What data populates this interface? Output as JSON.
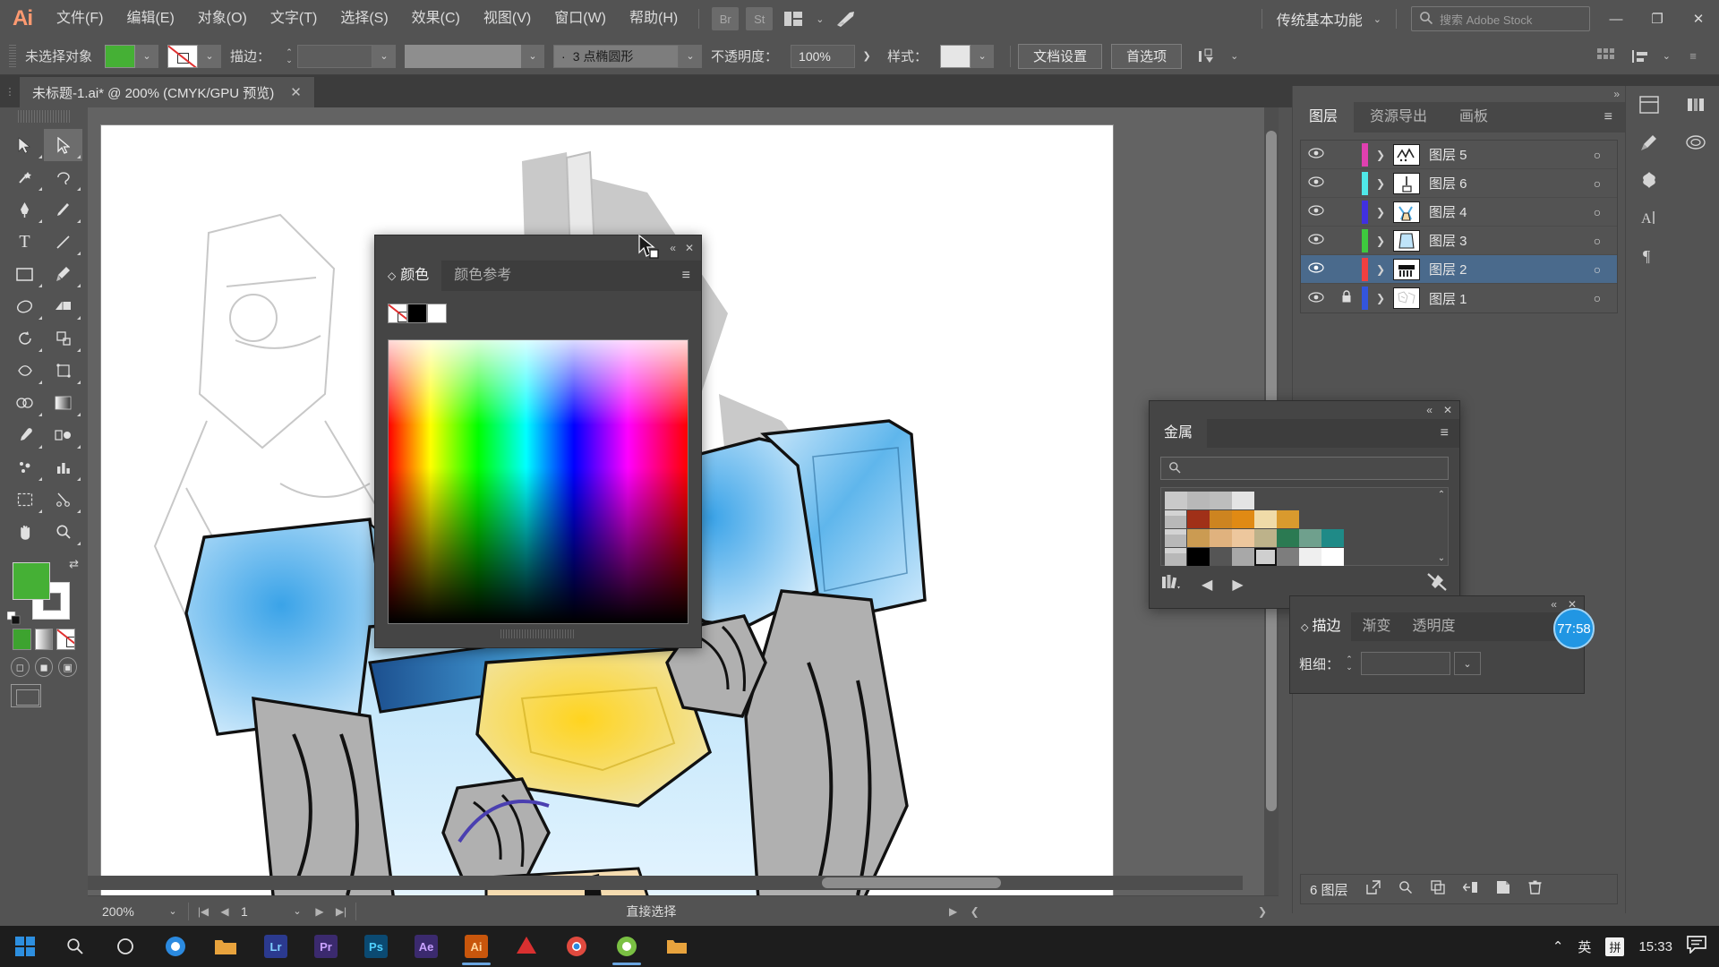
{
  "app": {
    "logo": "Ai",
    "menus": [
      "文件(F)",
      "编辑(E)",
      "对象(O)",
      "文字(T)",
      "选择(S)",
      "效果(C)",
      "视图(V)",
      "窗口(W)",
      "帮助(H)"
    ],
    "bridge_icon_label": "Br",
    "stock_icon_label": "St",
    "workspace": "传统基本功能",
    "search_placeholder": "搜索 Adobe Stock",
    "window_buttons": {
      "minimize": "—",
      "maximize": "❐",
      "close": "✕"
    }
  },
  "control_bar": {
    "selection_status": "未选择对象",
    "fill_color": "#45b035",
    "stroke_color": "none",
    "stroke_label": "描边：",
    "stroke_weight": "",
    "brush_profile": "",
    "brush_definition": "3 点椭圆形",
    "brush_bullet": "·",
    "opacity_label": "不透明度：",
    "opacity_value": "100%",
    "opacity_arrow": "❯",
    "style_label": "样式：",
    "document_setup": "文档设置",
    "preferences": "首选项",
    "align_caret": "⌄"
  },
  "document_tab": {
    "title": "未标题-1.ai* @ 200% (CMYK/GPU 预览)",
    "close": "✕"
  },
  "toolbar": {
    "tools": [
      {
        "name": "selection-tool",
        "glyph": "⬈",
        "selected": false
      },
      {
        "name": "direct-selection-tool",
        "glyph": "⬋",
        "selected": true
      },
      {
        "name": "magic-wand-tool",
        "glyph": "✧",
        "selected": false
      },
      {
        "name": "lasso-tool",
        "glyph": "◠",
        "selected": false
      },
      {
        "name": "pen-tool",
        "glyph": "✒",
        "selected": false
      },
      {
        "name": "curvature-tool",
        "glyph": "✎",
        "selected": false
      },
      {
        "name": "type-tool",
        "glyph": "T",
        "selected": false
      },
      {
        "name": "line-segment-tool",
        "glyph": "╱",
        "selected": false
      },
      {
        "name": "rectangle-tool",
        "glyph": "▭",
        "selected": false
      },
      {
        "name": "paintbrush-tool",
        "glyph": "🖌",
        "selected": false
      },
      {
        "name": "shaper-tool",
        "glyph": "◌",
        "selected": false
      },
      {
        "name": "eraser-tool",
        "glyph": "◨",
        "selected": false
      },
      {
        "name": "rotate-tool",
        "glyph": "↻",
        "selected": false
      },
      {
        "name": "scale-tool",
        "glyph": "⤢",
        "selected": false
      },
      {
        "name": "width-tool",
        "glyph": "⌘",
        "selected": false
      },
      {
        "name": "free-transform-tool",
        "glyph": "✛",
        "selected": false
      },
      {
        "name": "shape-builder-tool",
        "glyph": "◕",
        "selected": false
      },
      {
        "name": "gradient-tool",
        "glyph": "▦",
        "selected": false
      },
      {
        "name": "eyedropper-tool",
        "glyph": "⚲",
        "selected": false
      },
      {
        "name": "blend-tool",
        "glyph": "❏",
        "selected": false
      },
      {
        "name": "symbol-sprayer-tool",
        "glyph": "❋",
        "selected": false
      },
      {
        "name": "column-graph-tool",
        "glyph": "📊",
        "selected": false
      },
      {
        "name": "artboard-tool",
        "glyph": "⊞",
        "selected": false
      },
      {
        "name": "slice-tool",
        "glyph": "✂",
        "selected": false
      },
      {
        "name": "hand-tool",
        "glyph": "✋",
        "selected": false
      },
      {
        "name": "zoom-tool",
        "glyph": "🔍",
        "selected": false
      }
    ],
    "fill_color": "#45b035",
    "stroke_color": "#ffffff",
    "swap_glyph": "⇄",
    "screen_modes": [
      "normal",
      "full-menu",
      "full"
    ]
  },
  "color_panel": {
    "collapse": "«",
    "close": "✕",
    "tabs": [
      {
        "label": "颜色",
        "active": true
      },
      {
        "label": "颜色参考",
        "active": false
      }
    ],
    "menu_glyph": "≡",
    "swatches": [
      "none",
      "#000000",
      "#ffffff"
    ],
    "spectrum_label": "色谱"
  },
  "metal_panel": {
    "collapse": "«",
    "close": "✕",
    "tab": "金属",
    "menu_glyph": "≡",
    "search_icon": "search-icon",
    "search_value": "",
    "swatch_rows": [
      [
        "#c9c9c9",
        "#b8b8b8",
        "#bdbdbd",
        "#e4e4e4"
      ],
      [
        "__folder__",
        "#a03018",
        "#cd8420",
        "#e08a14",
        "#f0dba8",
        "#d99a2e"
      ],
      [
        "__folder__",
        "#cb9b52",
        "#e0b27e",
        "#edc79d",
        "#bdb28a",
        "#2b7a52",
        "#6fa08d",
        "#1f8a87"
      ],
      [
        "__folder__",
        "#000000",
        "#555555",
        "#a8a8a8",
        "#cfcfcf",
        "#7d7d7d",
        "#efefef",
        "#ffffff"
      ]
    ],
    "selected_swatch": "#cfcfcf",
    "footer": {
      "library": "swatch-libraries-icon",
      "prev": "◀",
      "next": "▶",
      "break_link": "break-link-icon"
    },
    "scroll_up": "⌃",
    "scroll_down": "⌄"
  },
  "stroke_panel": {
    "collapse": "«",
    "close": "✕",
    "tabs": [
      {
        "label": "描边",
        "active": true
      },
      {
        "label": "渐变",
        "active": false
      },
      {
        "label": "透明度",
        "active": false
      }
    ],
    "menu_glyph": "≡",
    "weight_label": "粗细：",
    "weight_value": "",
    "stepper": "⌃⌄",
    "dropdown": "⌄"
  },
  "time_badge": {
    "text": "77:58"
  },
  "layers_panel": {
    "collapse": "»",
    "tabs": [
      {
        "label": "图层",
        "active": true
      },
      {
        "label": "资源导出",
        "active": false
      },
      {
        "label": "画板",
        "active": false
      }
    ],
    "menu_glyph": "≡",
    "eye_glyph": "👁",
    "lock_glyph": "🔒",
    "expand_glyph": "❯",
    "target_glyph": "○",
    "rows": [
      {
        "name": "图层 5",
        "color": "#e040b0",
        "locked": false,
        "selected": false,
        "visible": true
      },
      {
        "name": "图层 6",
        "color": "#4fe8e8",
        "locked": false,
        "selected": false,
        "visible": true
      },
      {
        "name": "图层 4",
        "color": "#4030e0",
        "locked": false,
        "selected": false,
        "visible": true
      },
      {
        "name": "图层 3",
        "color": "#3ec93e",
        "locked": false,
        "selected": false,
        "visible": true
      },
      {
        "name": "图层 2",
        "color": "#f04040",
        "locked": false,
        "selected": true,
        "visible": true
      },
      {
        "name": "图层 1",
        "color": "#3355dd",
        "locked": true,
        "selected": false,
        "visible": true
      }
    ],
    "footer": {
      "count": "6 图层",
      "locate": "locate-object-icon",
      "search": "search-icon",
      "duplicate": "duplicate-layer-icon",
      "release": "release-to-layers-icon",
      "new_layer": "new-layer-icon",
      "delete": "delete-layer-icon"
    }
  },
  "dock_icons": [
    "properties-icon",
    "libraries-icon",
    "brushes-icon",
    "symbols-icon",
    "character-icon",
    "paragraph-icon"
  ],
  "status_bar": {
    "zoom": "200%",
    "zoom_caret": "⌄",
    "first_page": "|◀",
    "prev_page": "◀",
    "page": "1",
    "page_caret": "⌄",
    "next_page": "▶",
    "last_page": "▶|",
    "tool_status": "直接选择",
    "status_caret": "▶",
    "scroll_left": "❮",
    "scroll_right": "❯"
  },
  "taskbar": {
    "start": "⊞",
    "search": "search-icon",
    "cortana": "○",
    "apps": [
      {
        "name": "firefox",
        "label": "",
        "color": "#2b8ae0"
      },
      {
        "name": "explorer",
        "label": "",
        "color": "#e8a33d"
      },
      {
        "name": "adobe-lightroom",
        "label": "Lr",
        "color": "#2b3a8f"
      },
      {
        "name": "adobe-premiere",
        "label": "Pr",
        "color": "#3b2a6e"
      },
      {
        "name": "adobe-photoshop",
        "label": "Ps",
        "color": "#0b4a72"
      },
      {
        "name": "adobe-after-effects",
        "label": "Ae",
        "color": "#3b2a6e"
      },
      {
        "name": "adobe-illustrator",
        "label": "Ai",
        "color": "#c8560c"
      },
      {
        "name": "app-red",
        "label": "",
        "color": "#d93030"
      },
      {
        "name": "chrome",
        "label": "",
        "color": "#e04a3f"
      },
      {
        "name": "app-green",
        "label": "",
        "color": "#7ac043"
      },
      {
        "name": "app-folder",
        "label": "",
        "color": "#e8a33d"
      }
    ],
    "tray": {
      "chevron": "⌃",
      "ime_lang": "英",
      "ime_mode": "拼",
      "clock": "15:33",
      "notifications": "notification-icon"
    }
  }
}
